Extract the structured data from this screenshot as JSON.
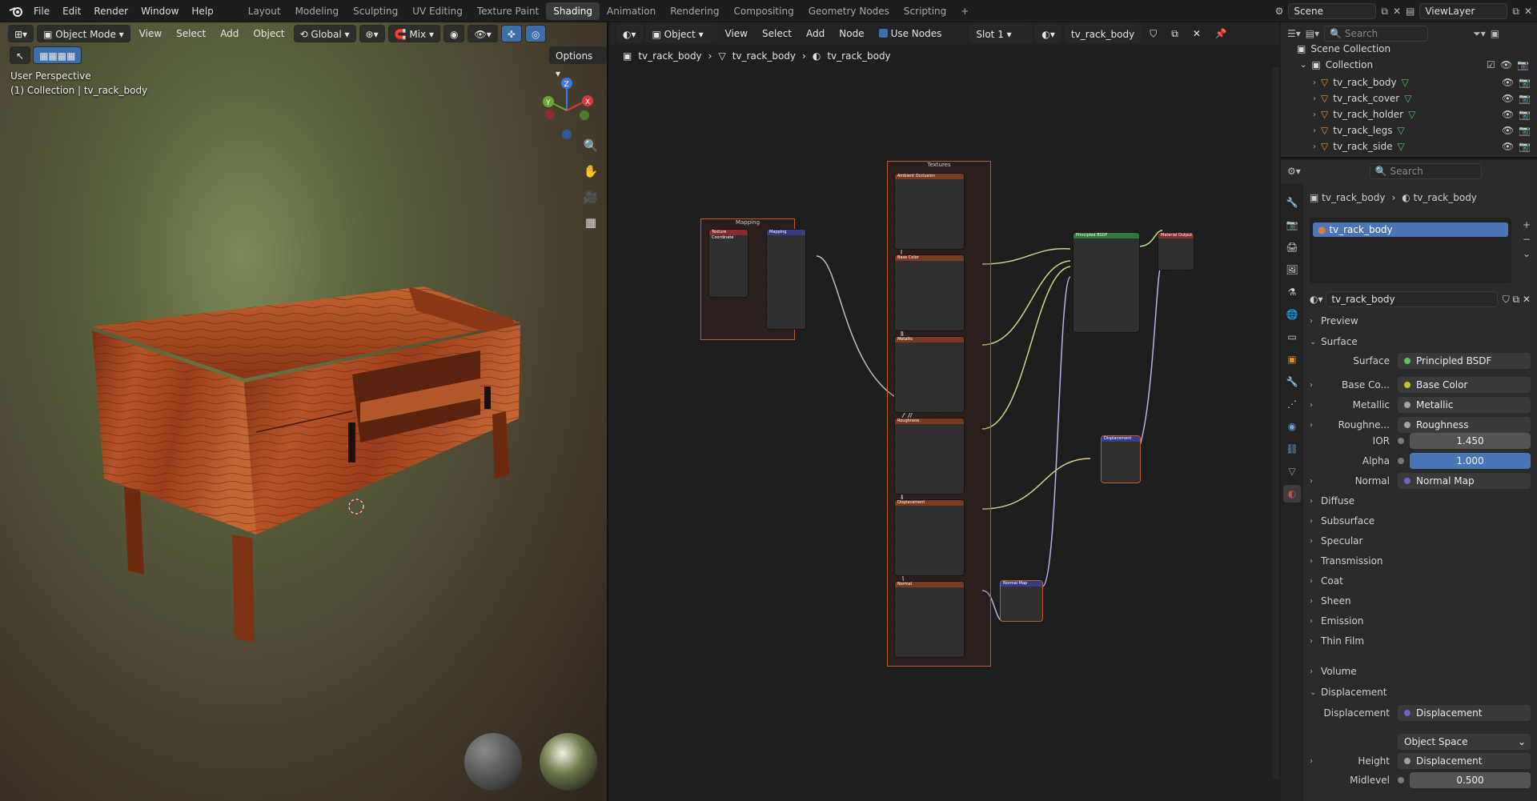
{
  "topbar": {
    "menus": [
      "File",
      "Edit",
      "Render",
      "Window",
      "Help"
    ],
    "workspaces": [
      "Layout",
      "Modeling",
      "Sculpting",
      "UV Editing",
      "Texture Paint",
      "Shading",
      "Animation",
      "Rendering",
      "Compositing",
      "Geometry Nodes",
      "Scripting"
    ],
    "active_workspace": "Shading",
    "add_tab": "+",
    "scene": "Scene",
    "view_layer": "ViewLayer"
  },
  "viewport": {
    "mode": "Object Mode",
    "menus": [
      "View",
      "Select",
      "Add",
      "Object"
    ],
    "orientation": "Global",
    "mix": "Mix",
    "options": "Options",
    "perspective": "User Perspective",
    "collection": "(1) Collection | tv_rack_body",
    "axes": {
      "z": "Z",
      "y": "Y",
      "x": "X"
    }
  },
  "node_editor": {
    "type": "Object",
    "menus": [
      "View",
      "Select",
      "Add",
      "Node"
    ],
    "use_nodes": "Use Nodes",
    "slot": "Slot 1",
    "material": "tv_rack_body",
    "breadcrumb": [
      "tv_rack_body",
      "tv_rack_body",
      "tv_rack_body"
    ],
    "frames": {
      "mapping": "Mapping",
      "textures": "Textures"
    },
    "nodes": {
      "texcoord": "Texture Coordinate",
      "mapping": "Mapping",
      "tex_titles": [
        "Ambient Occlusion",
        "Base Color",
        "Metallic",
        "Roughness",
        "Displacement",
        "Normal"
      ],
      "bsdf": "Principled BSDF",
      "output": "Material Output",
      "displacement": "Displacement",
      "normal_map": "Normal Map"
    }
  },
  "outliner": {
    "search_placeholder": "Search",
    "root": "Scene Collection",
    "collection": "Collection",
    "items": [
      "tv_rack_body",
      "tv_rack_cover",
      "tv_rack_holder",
      "tv_rack_legs",
      "tv_rack_side"
    ]
  },
  "properties": {
    "search_placeholder": "Search",
    "breadcrumb": [
      "tv_rack_body",
      "tv_rack_body"
    ],
    "slot_name": "tv_rack_body",
    "material_name": "tv_rack_body",
    "sections": {
      "preview": "Preview",
      "surface": "Surface",
      "volume": "Volume",
      "displacement": "Displacement"
    },
    "surface_row": {
      "label": "Surface",
      "value": "Principled BSDF"
    },
    "inputs": [
      {
        "label": "Base Co...",
        "value": "Base Color",
        "color": "#c7c12a"
      },
      {
        "label": "Metallic",
        "value": "Metallic",
        "color": "#a1a1a1"
      },
      {
        "label": "Roughne...",
        "value": "Roughness",
        "color": "#a1a1a1"
      }
    ],
    "ior": {
      "label": "IOR",
      "value": "1.450"
    },
    "alpha": {
      "label": "Alpha",
      "value": "1.000"
    },
    "normal": {
      "label": "Normal",
      "value": "Normal Map"
    },
    "subpanels": [
      "Diffuse",
      "Subsurface",
      "Specular",
      "Transmission",
      "Coat",
      "Sheen",
      "Emission",
      "Thin Film"
    ],
    "disp": {
      "label": "Displacement",
      "value": "Displacement",
      "space": "Object Space",
      "height_label": "Height",
      "height_value": "Displacement",
      "midlevel_label": "Midlevel",
      "midlevel_value": "0.500"
    }
  }
}
